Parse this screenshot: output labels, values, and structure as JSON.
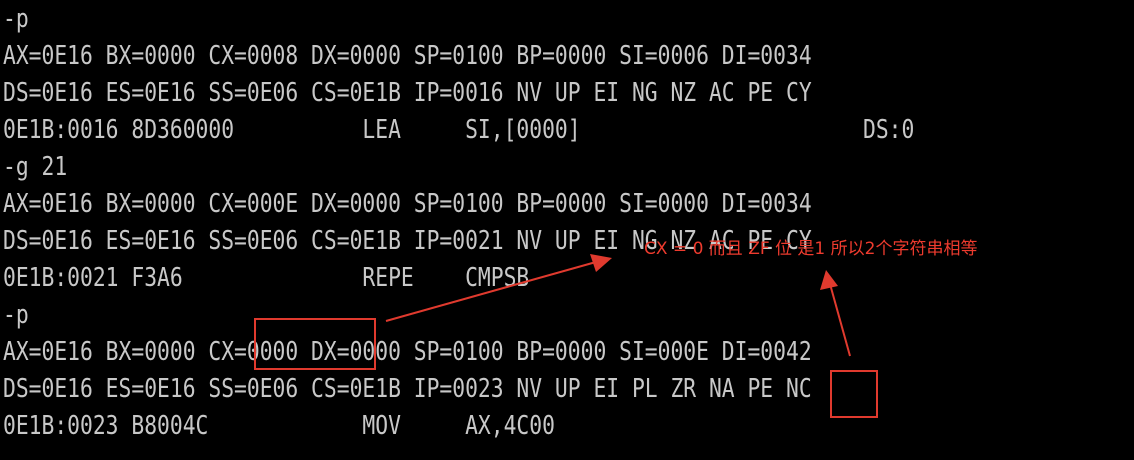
{
  "terminal": {
    "lines": [
      "-p",
      "AX=0E16 BX=0000 CX=0008 DX=0000 SP=0100 BP=0000 SI=0006 DI=0034",
      "DS=0E16 ES=0E16 SS=0E06 CS=0E1B IP=0016 NV UP EI NG NZ AC PE CY",
      "0E1B:0016 8D360000          LEA     SI,[0000]                      DS:0",
      "-g 21",
      "AX=0E16 BX=0000 CX=000E DX=0000 SP=0100 BP=0000 SI=0000 DI=0034",
      "DS=0E16 ES=0E16 SS=0E06 CS=0E1B IP=0021 NV UP EI NG NZ AC PE CY",
      "0E1B:0021 F3A6              REPE    CMPSB",
      "-p",
      "AX=0E16 BX=0000 CX=0000 DX=0000 SP=0100 BP=0000 SI=000E DI=0042",
      "DS=0E16 ES=0E16 SS=0E06 CS=0E1B IP=0023 NV UP EI PL ZR NA PE NC",
      "0E1B:0023 B8004C            MOV     AX,4C00"
    ]
  },
  "annotation": {
    "text": "CX = 0 而且 ZF 位 是1 所以2个字符串相等",
    "color": "#ee3b2e"
  },
  "colors": {
    "background": "#000000",
    "terminal_text": "#c8c8c8",
    "highlight": "#e03a2e"
  }
}
